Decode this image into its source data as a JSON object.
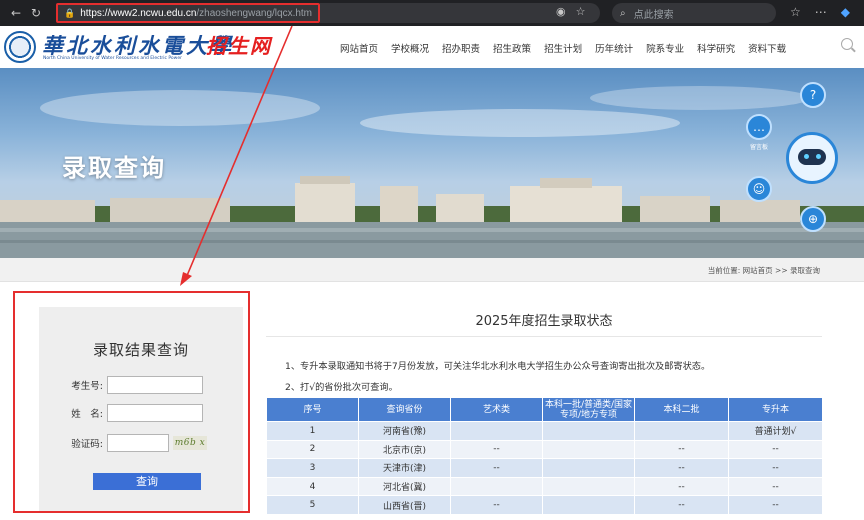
{
  "browser": {
    "url_host": "https://www2.ncwu.edu.cn",
    "url_path": "/zhaoshengwang/lqcx.htm",
    "search_placeholder": "点此搜索"
  },
  "site": {
    "logo_cn": "華北水利水電大學",
    "logo_en": "North China University of Water Resources and Electric Power",
    "logo_suffix": "招生网",
    "menu": [
      "网站首页",
      "学校概况",
      "招办职责",
      "招生政策",
      "招生计划",
      "历年统计",
      "院系专业",
      "科学研究",
      "资料下载"
    ]
  },
  "banner": {
    "title": "录取查询",
    "float_buttons": [
      {
        "label": "",
        "icon": "question-icon"
      },
      {
        "label": "留言板",
        "icon": "chat-icon"
      },
      {
        "label": "",
        "icon": "robot-icon"
      },
      {
        "label": "",
        "icon": "globe-icon"
      }
    ]
  },
  "breadcrumb": "当前位置: 网站首页 >> 录取查询",
  "query": {
    "title": "录取结果查询",
    "exam_no_label": "考生号:",
    "name_label": "姓　名:",
    "captcha_label": "验证码:",
    "captcha_text": "m6b x",
    "submit_label": "查询"
  },
  "status": {
    "title": "2025年度招生录取状态",
    "notes": [
      "1、专升本录取通知书将于7月份发放，可关注华北水利水电大学招生办公众号查询寄出批次及邮寄状态。",
      "2、打√的省份批次可查询。"
    ],
    "columns": [
      "序号",
      "查询省份",
      "艺术类",
      "本科一批/普通类/国家专项/地方专项",
      "本科二批",
      "专升本"
    ],
    "rows": [
      [
        "1",
        "河南省(豫)",
        "",
        "",
        "",
        "普通计划√"
      ],
      [
        "2",
        "北京市(京)",
        "--",
        "",
        "--",
        "--"
      ],
      [
        "3",
        "天津市(津)",
        "--",
        "",
        "--",
        "--"
      ],
      [
        "4",
        "河北省(冀)",
        "",
        "",
        "--",
        "--"
      ],
      [
        "5",
        "山西省(晋)",
        "--",
        "",
        "--",
        "--"
      ]
    ]
  },
  "colors": {
    "header_blue": "#4a7fd0",
    "row_blue": "#d9e4f3",
    "annotation_red": "#e52e2e",
    "submit_blue": "#3b6fd6"
  }
}
